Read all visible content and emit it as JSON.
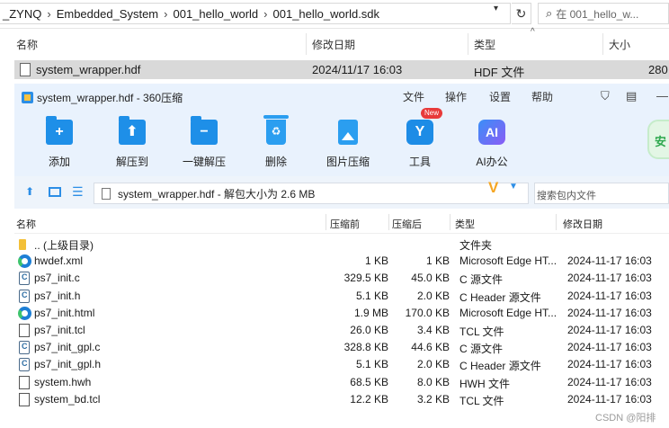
{
  "explorer": {
    "breadcrumb": [
      "_ZYNQ",
      "Embedded_System",
      "001_hello_world",
      "001_hello_world.sdk"
    ],
    "search_placeholder": "在 001_hello_w...",
    "columns": {
      "name": "名称",
      "date": "修改日期",
      "type": "类型",
      "size": "大小"
    },
    "row": {
      "name": "system_wrapper.hdf",
      "date": "2024/11/17 16:03",
      "type": "HDF 文件",
      "size": "280"
    }
  },
  "zip": {
    "title": "system_wrapper.hdf - 360压缩",
    "menu": [
      "文件",
      "操作",
      "设置",
      "帮助"
    ],
    "toolbar": [
      {
        "label": "添加"
      },
      {
        "label": "解压到"
      },
      {
        "label": "一键解压"
      },
      {
        "label": "删除"
      },
      {
        "label": "图片压缩"
      },
      {
        "label": "工具",
        "badge": "New"
      },
      {
        "label": "AI办公",
        "icon_text": "AI"
      }
    ],
    "shield_label": "安",
    "path_text": "system_wrapper.hdf - 解包大小为 2.6 MB",
    "search_placeholder": "搜索包内文件",
    "columns": {
      "name": "名称",
      "size": "压缩前",
      "packed": "压缩后",
      "type": "类型",
      "date": "修改日期"
    },
    "files": [
      {
        "icon": "folder-icon",
        "name": ".. (上级目录)",
        "size": "",
        "packed": "",
        "type": "文件夹",
        "date": ""
      },
      {
        "icon": "edge-icon",
        "name": "hwdef.xml",
        "size": "1 KB",
        "packed": "1 KB",
        "type": "Microsoft Edge HT...",
        "date": "2024-11-17 16:03"
      },
      {
        "icon": "c-file-icon",
        "name": "ps7_init.c",
        "size": "329.5 KB",
        "packed": "45.0 KB",
        "type": "C 源文件",
        "date": "2024-11-17 16:03"
      },
      {
        "icon": "c-file-icon",
        "name": "ps7_init.h",
        "size": "5.1 KB",
        "packed": "2.0 KB",
        "type": "C Header 源文件",
        "date": "2024-11-17 16:03"
      },
      {
        "icon": "edge-icon",
        "name": "ps7_init.html",
        "size": "1.9 MB",
        "packed": "170.0 KB",
        "type": "Microsoft Edge HT...",
        "date": "2024-11-17 16:03"
      },
      {
        "icon": "doc-icon",
        "name": "ps7_init.tcl",
        "size": "26.0 KB",
        "packed": "3.4 KB",
        "type": "TCL 文件",
        "date": "2024-11-17 16:03"
      },
      {
        "icon": "c-file-icon",
        "name": "ps7_init_gpl.c",
        "size": "328.8 KB",
        "packed": "44.6 KB",
        "type": "C 源文件",
        "date": "2024-11-17 16:03"
      },
      {
        "icon": "c-file-icon",
        "name": "ps7_init_gpl.h",
        "size": "5.1 KB",
        "packed": "2.0 KB",
        "type": "C Header 源文件",
        "date": "2024-11-17 16:03"
      },
      {
        "icon": "doc-icon",
        "name": "system.hwh",
        "size": "68.5 KB",
        "packed": "8.0 KB",
        "type": "HWH 文件",
        "date": "2024-11-17 16:03"
      },
      {
        "icon": "doc-icon",
        "name": "system_bd.tcl",
        "size": "12.2 KB",
        "packed": "3.2 KB",
        "type": "TCL 文件",
        "date": "2024-11-17 16:03"
      }
    ]
  },
  "watermark": "CSDN @阳排"
}
